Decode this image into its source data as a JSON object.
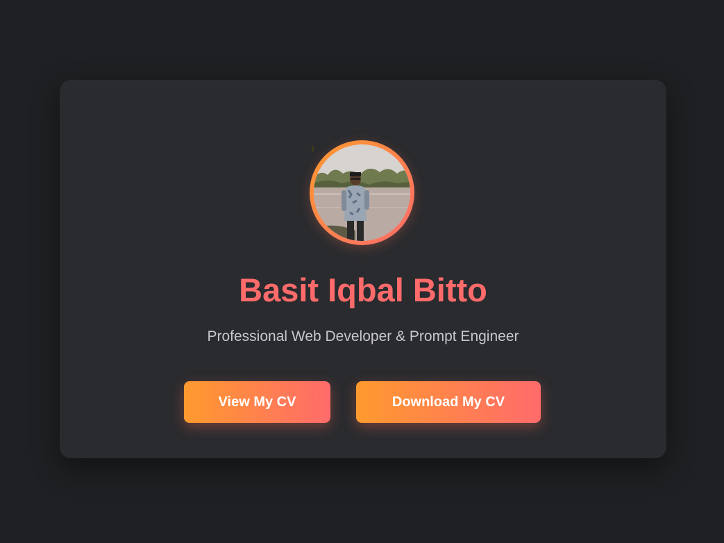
{
  "profile": {
    "name": "Basit Iqbal Bitto",
    "tagline": "Professional Web Developer & Prompt Engineer",
    "avatar_icon": "profile-photo"
  },
  "actions": {
    "view_cv_label": "View My CV",
    "download_cv_label": "Download My CV"
  },
  "colors": {
    "background": "#1f2023",
    "card": "#2a2b2f",
    "accent_start": "#ff9a2e",
    "accent_end": "#ff6b6b",
    "name": "#ff6b6b",
    "tagline": "#c8c8cc"
  }
}
